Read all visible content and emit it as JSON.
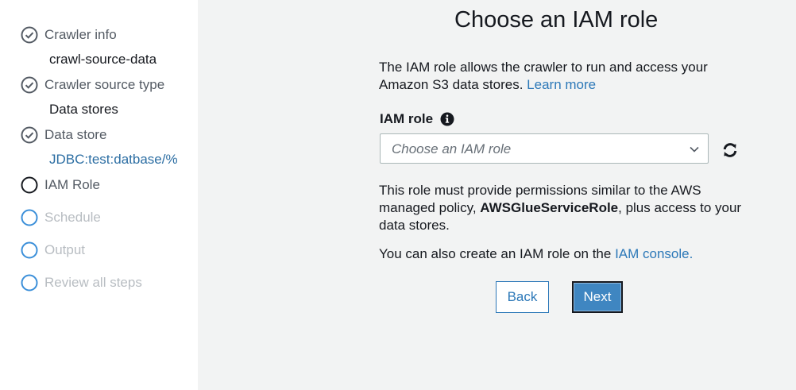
{
  "sidebar": {
    "steps": [
      {
        "label": "Crawler info",
        "detail": "crawl-source-data",
        "status": "done"
      },
      {
        "label": "Crawler source type",
        "detail": "Data stores",
        "status": "done"
      },
      {
        "label": "Data store",
        "detail": "JDBC:test:datbase/%",
        "status": "done"
      },
      {
        "label": "IAM Role",
        "status": "current"
      },
      {
        "label": "Schedule",
        "status": "pending"
      },
      {
        "label": "Output",
        "status": "pending"
      },
      {
        "label": "Review all steps",
        "status": "pending"
      }
    ]
  },
  "main": {
    "title": "Choose an IAM role",
    "intro_text": "The IAM role allows the crawler to run and access your Amazon S3 data stores.",
    "learn_more": "Learn more",
    "field_label": "IAM role",
    "select_placeholder": "Choose an IAM role",
    "policy_text_1": "This role must provide permissions similar to the AWS managed policy,",
    "policy_name": "AWSGlueServiceRole",
    "policy_text_2": ", plus access to your data stores.",
    "console_text": "You can also create an IAM role on the",
    "console_link": "IAM console.",
    "back_label": "Back",
    "next_label": "Next"
  },
  "colors": {
    "done": "#545b64",
    "pending": "#3b8fd9",
    "link": "#2c78b8",
    "primary_button": "#3f86c1"
  }
}
